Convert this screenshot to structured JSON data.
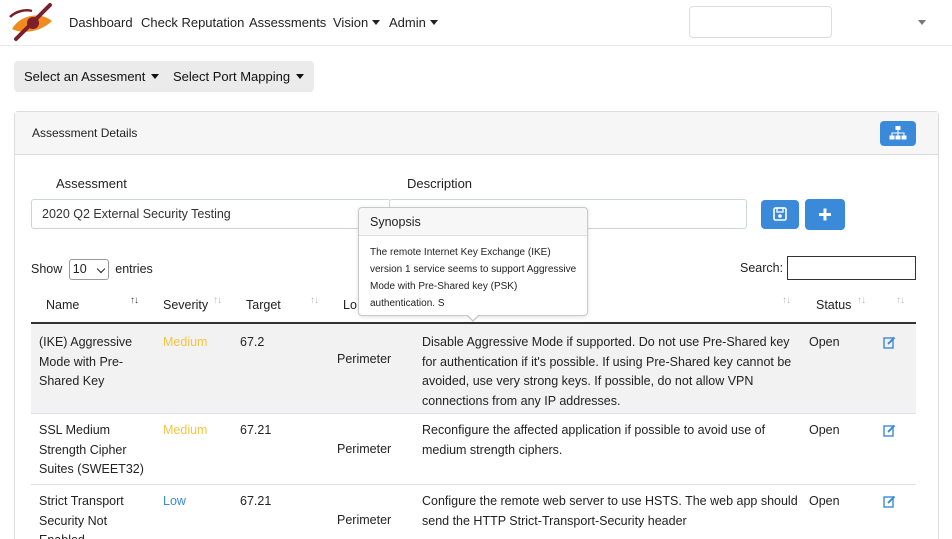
{
  "nav": {
    "logo_icon": "eye-logo-icon",
    "items": [
      {
        "label": "Dashboard",
        "dropdown": false
      },
      {
        "label": "Check Reputation",
        "dropdown": false
      },
      {
        "label": "Assessments",
        "dropdown": false
      },
      {
        "label": "Vision",
        "dropdown": true
      },
      {
        "label": "Admin",
        "dropdown": true
      }
    ],
    "search_value": ""
  },
  "toolbar": {
    "select_assessment": "Select an Assesment",
    "select_port_mapping": "Select Port Mapping"
  },
  "card": {
    "title": "Assessment Details",
    "assessment_label": "Assessment",
    "assessment_value": "2020 Q2 External Security Testing",
    "description_label": "Description",
    "description_value": ""
  },
  "table_controls": {
    "show_prefix": "Show",
    "page_size": "10",
    "show_suffix": "entries",
    "search_label": "Search:",
    "search_value": ""
  },
  "table": {
    "headers": [
      "Name",
      "Severity",
      "Target",
      "Lo",
      "",
      "Status",
      ""
    ],
    "rows": [
      {
        "name": "(IKE) Aggressive Mode with Pre-Shared Key",
        "severity": "Medium",
        "target": "67.2",
        "location": "Perimeter",
        "remediation": "Disable Aggressive Mode if supported. Do not use Pre-Shared key for authentication if it's possible. If using Pre-Shared key cannot be avoided, use very strong keys. If possible, do not allow VPN connections from any IP addresses.",
        "status": "Open"
      },
      {
        "name": "SSL Medium Strength Cipher Suites (SWEET32)",
        "severity": "Medium",
        "target": "67.21",
        "location": "Perimeter",
        "remediation": "Reconfigure the affected application if possible to avoid use of medium strength ciphers.",
        "status": "Open"
      },
      {
        "name": "Strict Transport Security Not Enabled",
        "severity": "Low",
        "target": "67.21",
        "location": "Perimeter",
        "remediation": "Configure the remote web server to use HSTS. The web app should send the HTTP Strict-Transport-Security header",
        "status": "Open"
      }
    ]
  },
  "tooltip": {
    "title": "Synopsis",
    "body": "The remote Internet Key Exchange (IKE) version 1 service seems to support Aggressive Mode with Pre-Shared key (PSK) authentication. S"
  },
  "colors": {
    "primary": "#3b8ad9",
    "medium": "#f5c542",
    "low": "#3b8ad9",
    "logo_orange": "#f28b1e",
    "logo_maroon": "#7a1f2b"
  }
}
